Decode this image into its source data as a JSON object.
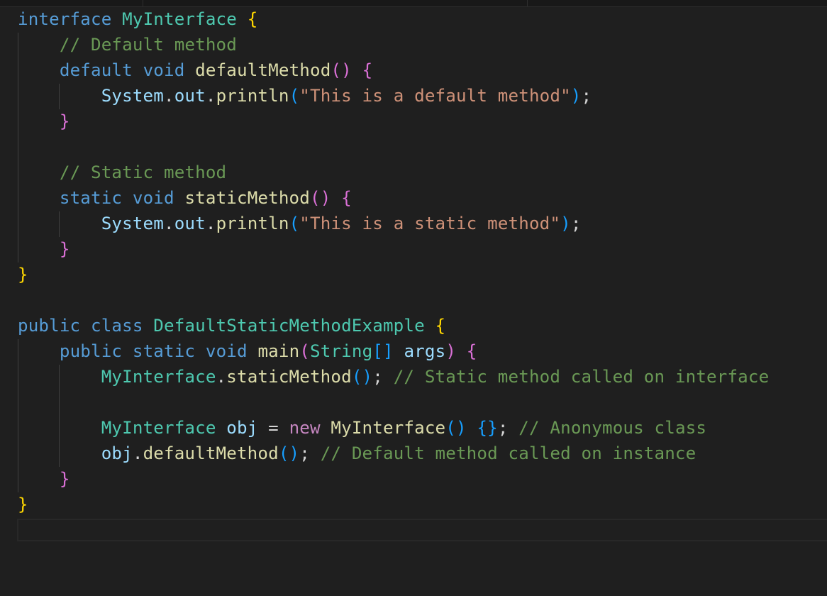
{
  "editor": {
    "language": "java",
    "theme_colors": {
      "background": "#1f1f1f",
      "keyword": "#569cd6",
      "control_keyword": "#c586c0",
      "type": "#4ec9b0",
      "function": "#dcdcaa",
      "variable": "#9cdcfe",
      "string": "#ce9178",
      "comment": "#6a9955",
      "bracket_level_1": "#ffd700",
      "bracket_level_2": "#da70d6",
      "bracket_level_3": "#179fff"
    },
    "tokens": {
      "interface": "interface",
      "MyInterface": "MyInterface",
      "cmt_default": "// Default method",
      "default": "default",
      "void": "void",
      "defaultMethod": "defaultMethod",
      "System": "System",
      "out": "out",
      "println": "println",
      "str_default": "\"This is a default method\"",
      "cmt_static": "// Static method",
      "static": "static",
      "staticMethod": "staticMethod",
      "str_static": "\"This is a static method\"",
      "public": "public",
      "class": "class",
      "DefaultStaticMethodExample": "DefaultStaticMethodExample",
      "main": "main",
      "String": "String",
      "args": "args",
      "cmt_static_call": "// Static method called on interface",
      "obj": "obj",
      "new": "new",
      "cmt_anon": "// Anonymous class",
      "cmt_default_call": "// Default method called on instance"
    }
  }
}
